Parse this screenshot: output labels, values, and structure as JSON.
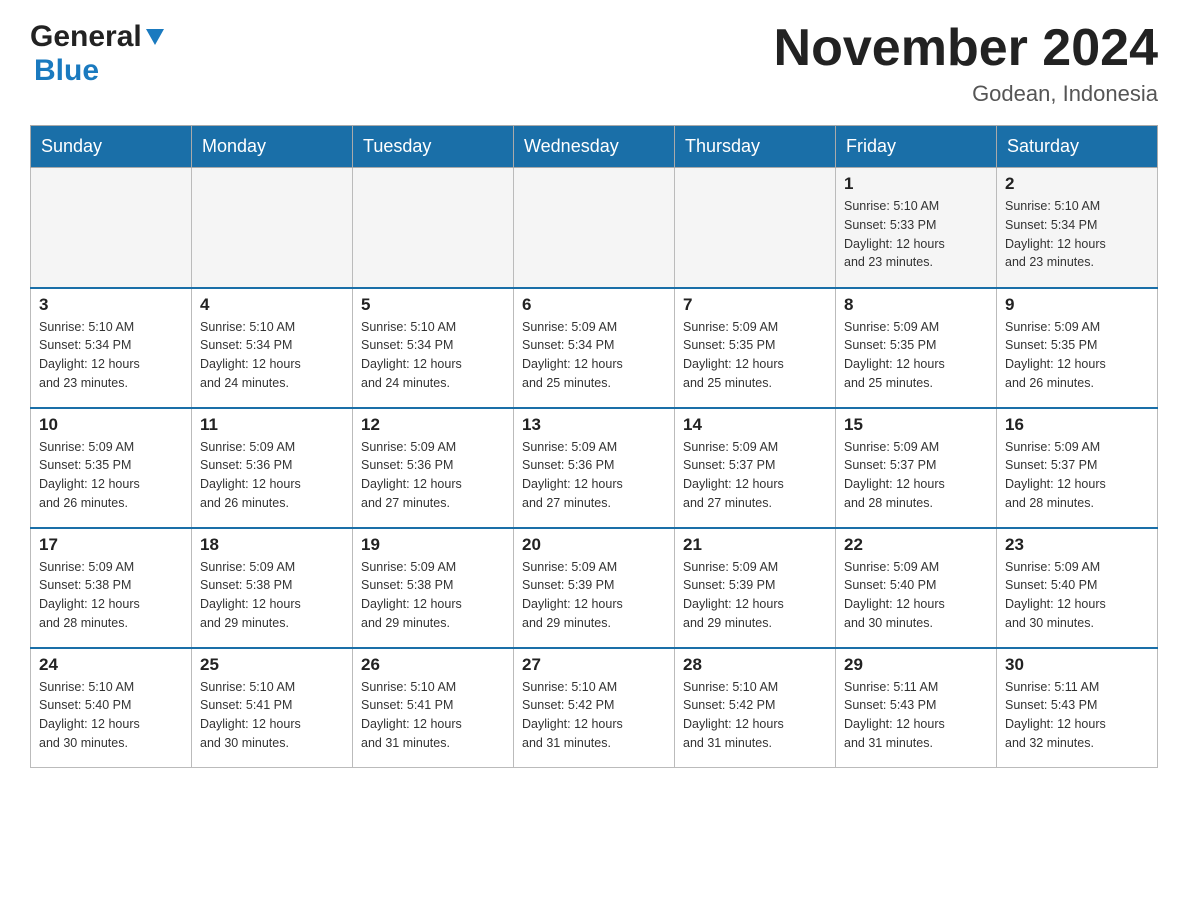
{
  "header": {
    "logo_general": "General",
    "logo_blue": "Blue",
    "month_title": "November 2024",
    "location": "Godean, Indonesia"
  },
  "weekdays": [
    "Sunday",
    "Monday",
    "Tuesday",
    "Wednesday",
    "Thursday",
    "Friday",
    "Saturday"
  ],
  "weeks": [
    [
      {
        "day": "",
        "info": ""
      },
      {
        "day": "",
        "info": ""
      },
      {
        "day": "",
        "info": ""
      },
      {
        "day": "",
        "info": ""
      },
      {
        "day": "",
        "info": ""
      },
      {
        "day": "1",
        "info": "Sunrise: 5:10 AM\nSunset: 5:33 PM\nDaylight: 12 hours\nand 23 minutes."
      },
      {
        "day": "2",
        "info": "Sunrise: 5:10 AM\nSunset: 5:34 PM\nDaylight: 12 hours\nand 23 minutes."
      }
    ],
    [
      {
        "day": "3",
        "info": "Sunrise: 5:10 AM\nSunset: 5:34 PM\nDaylight: 12 hours\nand 23 minutes."
      },
      {
        "day": "4",
        "info": "Sunrise: 5:10 AM\nSunset: 5:34 PM\nDaylight: 12 hours\nand 24 minutes."
      },
      {
        "day": "5",
        "info": "Sunrise: 5:10 AM\nSunset: 5:34 PM\nDaylight: 12 hours\nand 24 minutes."
      },
      {
        "day": "6",
        "info": "Sunrise: 5:09 AM\nSunset: 5:34 PM\nDaylight: 12 hours\nand 25 minutes."
      },
      {
        "day": "7",
        "info": "Sunrise: 5:09 AM\nSunset: 5:35 PM\nDaylight: 12 hours\nand 25 minutes."
      },
      {
        "day": "8",
        "info": "Sunrise: 5:09 AM\nSunset: 5:35 PM\nDaylight: 12 hours\nand 25 minutes."
      },
      {
        "day": "9",
        "info": "Sunrise: 5:09 AM\nSunset: 5:35 PM\nDaylight: 12 hours\nand 26 minutes."
      }
    ],
    [
      {
        "day": "10",
        "info": "Sunrise: 5:09 AM\nSunset: 5:35 PM\nDaylight: 12 hours\nand 26 minutes."
      },
      {
        "day": "11",
        "info": "Sunrise: 5:09 AM\nSunset: 5:36 PM\nDaylight: 12 hours\nand 26 minutes."
      },
      {
        "day": "12",
        "info": "Sunrise: 5:09 AM\nSunset: 5:36 PM\nDaylight: 12 hours\nand 27 minutes."
      },
      {
        "day": "13",
        "info": "Sunrise: 5:09 AM\nSunset: 5:36 PM\nDaylight: 12 hours\nand 27 minutes."
      },
      {
        "day": "14",
        "info": "Sunrise: 5:09 AM\nSunset: 5:37 PM\nDaylight: 12 hours\nand 27 minutes."
      },
      {
        "day": "15",
        "info": "Sunrise: 5:09 AM\nSunset: 5:37 PM\nDaylight: 12 hours\nand 28 minutes."
      },
      {
        "day": "16",
        "info": "Sunrise: 5:09 AM\nSunset: 5:37 PM\nDaylight: 12 hours\nand 28 minutes."
      }
    ],
    [
      {
        "day": "17",
        "info": "Sunrise: 5:09 AM\nSunset: 5:38 PM\nDaylight: 12 hours\nand 28 minutes."
      },
      {
        "day": "18",
        "info": "Sunrise: 5:09 AM\nSunset: 5:38 PM\nDaylight: 12 hours\nand 29 minutes."
      },
      {
        "day": "19",
        "info": "Sunrise: 5:09 AM\nSunset: 5:38 PM\nDaylight: 12 hours\nand 29 minutes."
      },
      {
        "day": "20",
        "info": "Sunrise: 5:09 AM\nSunset: 5:39 PM\nDaylight: 12 hours\nand 29 minutes."
      },
      {
        "day": "21",
        "info": "Sunrise: 5:09 AM\nSunset: 5:39 PM\nDaylight: 12 hours\nand 29 minutes."
      },
      {
        "day": "22",
        "info": "Sunrise: 5:09 AM\nSunset: 5:40 PM\nDaylight: 12 hours\nand 30 minutes."
      },
      {
        "day": "23",
        "info": "Sunrise: 5:09 AM\nSunset: 5:40 PM\nDaylight: 12 hours\nand 30 minutes."
      }
    ],
    [
      {
        "day": "24",
        "info": "Sunrise: 5:10 AM\nSunset: 5:40 PM\nDaylight: 12 hours\nand 30 minutes."
      },
      {
        "day": "25",
        "info": "Sunrise: 5:10 AM\nSunset: 5:41 PM\nDaylight: 12 hours\nand 30 minutes."
      },
      {
        "day": "26",
        "info": "Sunrise: 5:10 AM\nSunset: 5:41 PM\nDaylight: 12 hours\nand 31 minutes."
      },
      {
        "day": "27",
        "info": "Sunrise: 5:10 AM\nSunset: 5:42 PM\nDaylight: 12 hours\nand 31 minutes."
      },
      {
        "day": "28",
        "info": "Sunrise: 5:10 AM\nSunset: 5:42 PM\nDaylight: 12 hours\nand 31 minutes."
      },
      {
        "day": "29",
        "info": "Sunrise: 5:11 AM\nSunset: 5:43 PM\nDaylight: 12 hours\nand 31 minutes."
      },
      {
        "day": "30",
        "info": "Sunrise: 5:11 AM\nSunset: 5:43 PM\nDaylight: 12 hours\nand 32 minutes."
      }
    ]
  ]
}
